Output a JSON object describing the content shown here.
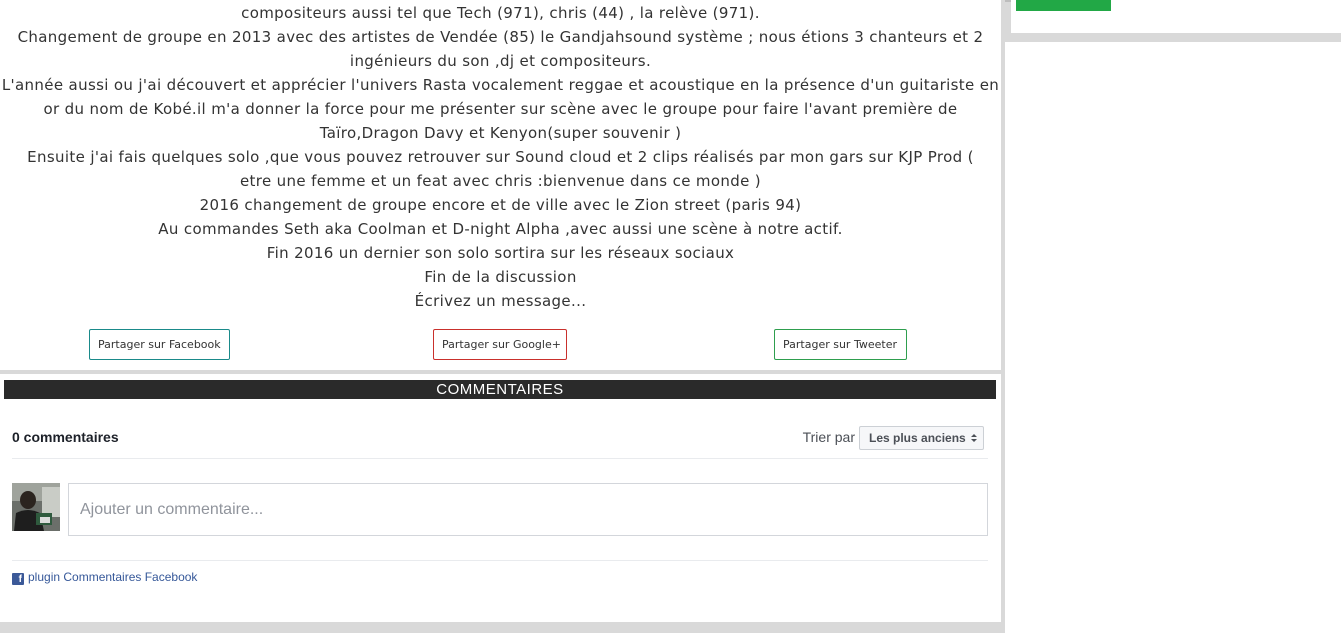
{
  "article": {
    "lines": [
      "compositeurs aussi tel que Tech (971), chris (44) , la relève (971).",
      "Changement de groupe en 2013 avec des artistes de Vendée (85) le Gandjahsound système ; nous étions 3 chanteurs et 2",
      "ingénieurs du son ,dj et compositeurs.",
      "L'année aussi ou j'ai découvert et apprécier l'univers Rasta vocalement reggae et acoustique en la présence d'un guitariste en",
      "or du nom de Kobé.il m'a donner la force pour me présenter sur scène avec le groupe pour faire l'avant première de",
      "Taïro,Dragon Davy et Kenyon(super souvenir )",
      "Ensuite j'ai fais quelques solo ,que vous pouvez retrouver sur Sound cloud et 2 clips réalisés par mon gars sur KJP Prod (",
      "etre une femme et un feat avec chris :bienvenue dans ce monde )",
      "2016 changement de groupe encore et de ville avec le Zion street (paris 94)",
      "Au commandes Seth aka Coolman et D-night Alpha ,avec aussi une scène à notre actif.",
      "Fin 2016 un dernier son solo sortira sur les réseaux sociaux",
      "Fin de la discussion",
      "Écrivez un message..."
    ]
  },
  "share": {
    "facebook_label": "Partager sur Facebook",
    "google_label": "Partager sur Google+",
    "twitter_label": "Partager sur Tweeter",
    "facebook_color": "#1a8a8a",
    "google_color": "#c9302c",
    "twitter_color": "#2e9e4e"
  },
  "comments": {
    "header": "COMMENTAIRES",
    "count": "0 commentaires",
    "sort_label": "Trier par",
    "sort_value": "Les plus anciens",
    "input_placeholder": "Ajouter un commentaire...",
    "plugin_label": "plugin Commentaires Facebook",
    "fb_logo_glyph": "f"
  },
  "sidebar": {
    "accent_color": "#22a846"
  }
}
